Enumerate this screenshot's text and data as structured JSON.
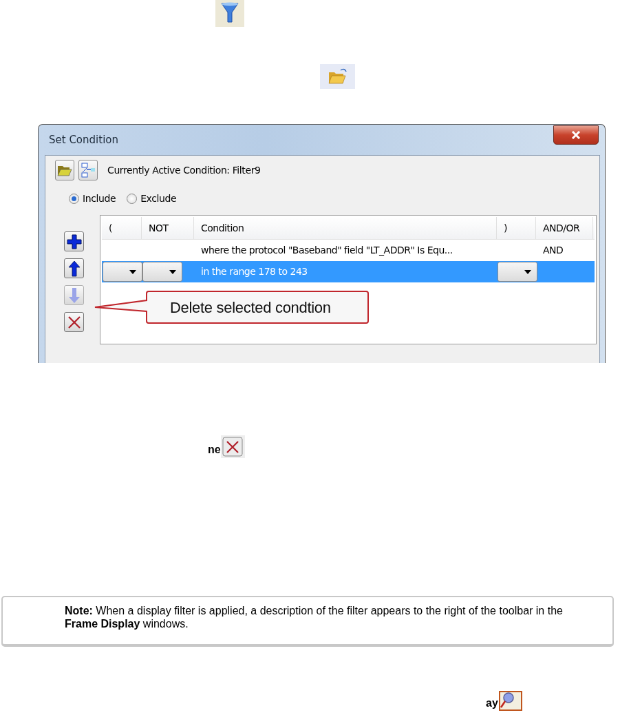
{
  "fragments": [
    {
      "text": "ne"
    },
    {
      "text": "ay"
    }
  ],
  "dialog": {
    "title": "Set Condition",
    "active_condition": "Currently Active Condition:  Filter9",
    "radios": [
      {
        "label": "Include",
        "selected": true
      },
      {
        "label": "Exclude",
        "selected": false
      }
    ],
    "columns": [
      "(",
      "NOT",
      "Condition",
      ")",
      "AND/OR"
    ],
    "rows": [
      {
        "condition": "where the protocol \"Baseband\" field \"LT_ADDR\" Is Equ...",
        "and_or": "AND",
        "selected": false,
        "editing": false
      },
      {
        "condition": "in the range 178 to 243",
        "selected": true,
        "editing": true
      }
    ],
    "side_buttons": [
      {
        "kind": "add",
        "disabled": false
      },
      {
        "kind": "up",
        "disabled": false
      },
      {
        "kind": "down",
        "disabled": true
      },
      {
        "kind": "delete",
        "disabled": false
      }
    ],
    "callout": "Delete selected condtion"
  },
  "note": "**Note:** When a display filter is applied, a description of the filter appears to the right of the toolbar in the **Frame Display** windows."
}
